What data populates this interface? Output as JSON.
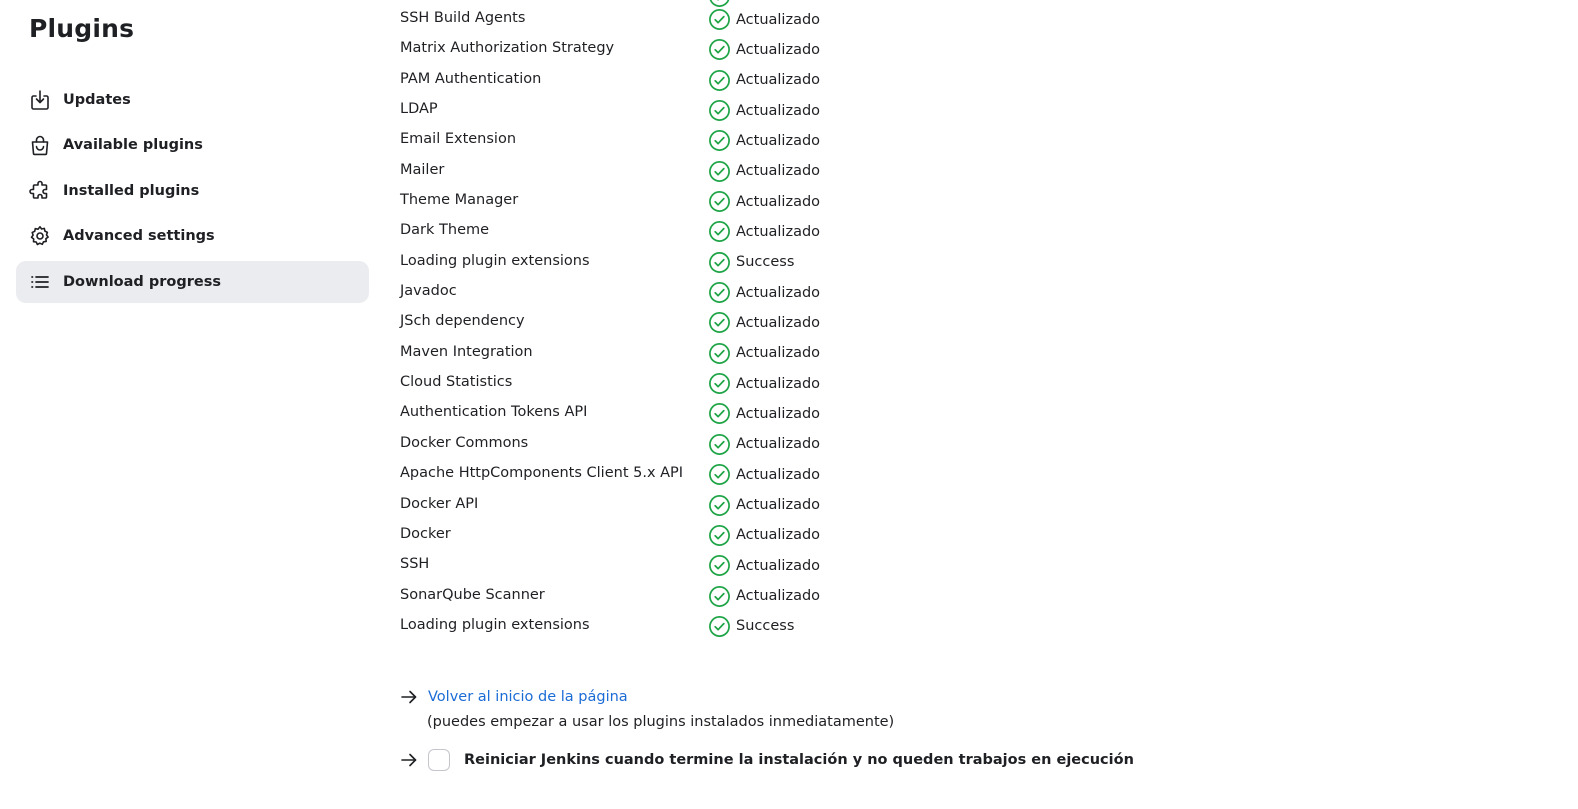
{
  "page": {
    "title": "Plugins"
  },
  "sidebar": {
    "items": [
      {
        "label": "Updates",
        "icon": "download-icon",
        "active": false
      },
      {
        "label": "Available plugins",
        "icon": "shopping-bag-icon",
        "active": false
      },
      {
        "label": "Installed plugins",
        "icon": "puzzle-piece-icon",
        "active": false
      },
      {
        "label": "Advanced settings",
        "icon": "gear-icon",
        "active": false
      },
      {
        "label": "Download progress",
        "icon": "list-icon",
        "active": true
      }
    ]
  },
  "plugins": [
    {
      "name": "SSH Build Agents",
      "status": "Actualizado"
    },
    {
      "name": "Matrix Authorization Strategy",
      "status": "Actualizado"
    },
    {
      "name": "PAM Authentication",
      "status": "Actualizado"
    },
    {
      "name": "LDAP",
      "status": "Actualizado"
    },
    {
      "name": "Email Extension",
      "status": "Actualizado"
    },
    {
      "name": "Mailer",
      "status": "Actualizado"
    },
    {
      "name": "Theme Manager",
      "status": "Actualizado"
    },
    {
      "name": "Dark Theme",
      "status": "Actualizado"
    },
    {
      "name": "Loading plugin extensions",
      "status": "Success"
    },
    {
      "name": "Javadoc",
      "status": "Actualizado"
    },
    {
      "name": "JSch dependency",
      "status": "Actualizado"
    },
    {
      "name": "Maven Integration",
      "status": "Actualizado"
    },
    {
      "name": "Cloud Statistics",
      "status": "Actualizado"
    },
    {
      "name": "Authentication Tokens API",
      "status": "Actualizado"
    },
    {
      "name": "Docker Commons",
      "status": "Actualizado"
    },
    {
      "name": "Apache HttpComponents Client 5.x API",
      "status": "Actualizado"
    },
    {
      "name": "Docker API",
      "status": "Actualizado"
    },
    {
      "name": "Docker",
      "status": "Actualizado"
    },
    {
      "name": "SSH",
      "status": "Actualizado"
    },
    {
      "name": "SonarQube Scanner",
      "status": "Actualizado"
    },
    {
      "name": "Loading plugin extensions",
      "status": "Success"
    }
  ],
  "footer": {
    "back_link": "Volver al inicio de la página",
    "back_hint": "(puedes empezar a usar los plugins instalados inmediatamente)",
    "restart_label": "Reiniciar Jenkins cuando termine la instalación y no queden trabajos en ejecución",
    "restart_checked": false
  },
  "colors": {
    "success": "#1ea446",
    "link": "#1c6cd6",
    "active_nav_bg": "#ebecef",
    "text": "#1f2024"
  }
}
